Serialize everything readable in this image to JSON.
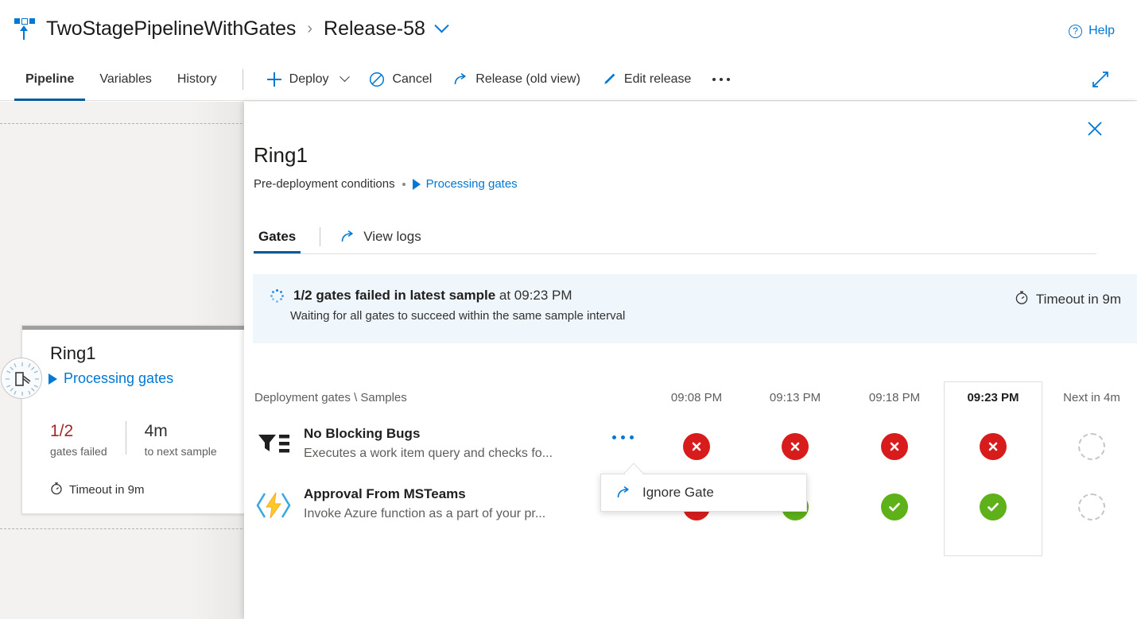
{
  "breadcrumb": {
    "pipeline_icon": "release-pipeline-icon",
    "pipeline_name": "TwoStagePipelineWithGates",
    "separator": "›",
    "release_name": "Release-58"
  },
  "help": {
    "label": "Help",
    "icon": "question-circle-icon"
  },
  "commandbar": {
    "tabs": [
      {
        "label": "Pipeline",
        "selected": true
      },
      {
        "label": "Variables",
        "selected": false
      },
      {
        "label": "History",
        "selected": false
      }
    ],
    "actions": [
      {
        "label": "Deploy",
        "icon": "plus-icon",
        "has_chevron": true
      },
      {
        "label": "Cancel",
        "icon": "cancel-circle-icon",
        "has_chevron": false
      },
      {
        "label": "Release (old view)",
        "icon": "share-arrow-icon",
        "has_chevron": false
      },
      {
        "label": "Edit release",
        "icon": "pencil-icon",
        "has_chevron": false
      }
    ],
    "overflow_label": "…",
    "expand_icon": "fullscreen-expand-icon"
  },
  "stage_card": {
    "status_icon": "gate-clock-icon",
    "title": "Ring1",
    "status_label": "Processing gates",
    "status_icon_play": "play-triangle-icon",
    "stats": [
      {
        "value": "1/2",
        "caption": "gates failed",
        "color": "#a4262c"
      },
      {
        "value": "4m",
        "caption": "to next sample",
        "color": "#323130"
      }
    ],
    "timeout_icon": "timer-icon",
    "timeout_label": "Timeout in 9m"
  },
  "panel": {
    "close_icon": "close-x-icon",
    "title": "Ring1",
    "subtitle": "Pre-deployment conditions",
    "subtitle_link": "Processing gates",
    "pivot": {
      "tab_label": "Gates",
      "link_label": "View logs",
      "link_icon": "share-arrow-icon"
    },
    "banner": {
      "spinner_icon": "loading-spinner-icon",
      "headline_strong": "1/2 gates failed in latest sample",
      "headline_rest": " at 09:23 PM",
      "detail": "Waiting for all gates to succeed within the same sample interval",
      "timeout_icon": "timer-icon",
      "timeout_label": "Timeout in 9m",
      "background": "#eff6fc"
    },
    "table": {
      "row_header": "Deployment gates \\ Samples",
      "columns": [
        {
          "label": "09:08 PM",
          "active": false
        },
        {
          "label": "09:13 PM",
          "active": false
        },
        {
          "label": "09:18 PM",
          "active": false
        },
        {
          "label": "09:23 PM",
          "active": true
        },
        {
          "label": "Next in 4m",
          "active": false
        }
      ],
      "rows": [
        {
          "icon": "work-item-query-icon",
          "name": "No Blocking Bugs",
          "description": "Executes a work item query and checks fo...",
          "has_overflow": true,
          "overflow_label": "…",
          "samples": [
            "failed",
            "failed",
            "failed",
            "failed",
            "pending"
          ]
        },
        {
          "icon": "azure-function-icon",
          "name": "Approval From MSTeams",
          "description": "Invoke Azure function as a part of your pr...",
          "has_overflow": false,
          "overflow_label": "",
          "samples": [
            "failed",
            "passed",
            "passed",
            "passed",
            "pending"
          ]
        }
      ]
    },
    "callout": {
      "icon": "share-arrow-icon",
      "label": "Ignore Gate"
    }
  },
  "colors": {
    "accent": "#0078d4",
    "fail": "#d81c1c",
    "pass": "#5eb118",
    "error_text": "#a4262c",
    "selected_tab_underline": "#005a9e"
  }
}
